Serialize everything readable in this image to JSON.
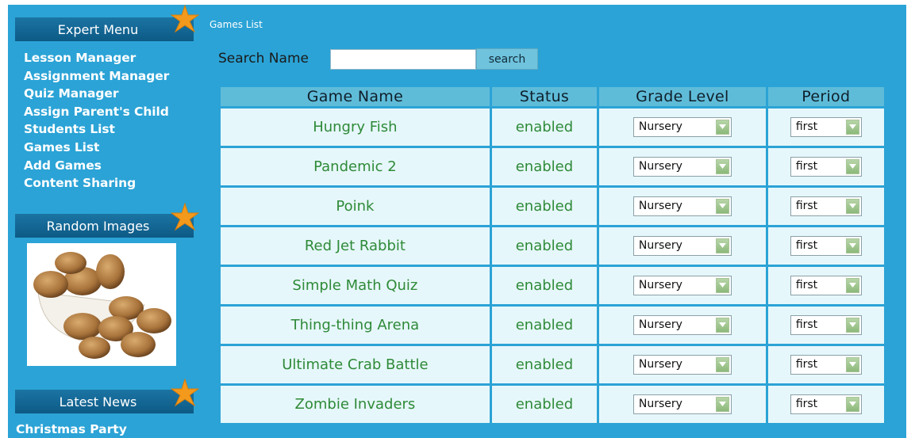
{
  "sidebar": {
    "expert_menu_title": "Expert Menu",
    "menu_items": [
      "Lesson Manager",
      "Assignment Manager",
      "Quiz Manager",
      "Assign Parent's Child",
      "Students List",
      "Games List",
      "Add Games",
      "Content Sharing"
    ],
    "random_images_title": "Random Images",
    "random_image_icon": "potatoes-in-bowl-image",
    "latest_news_title": "Latest News",
    "news_items": [
      "Christmas Party"
    ]
  },
  "breadcrumb": "Games List",
  "search": {
    "label": "Search Name",
    "value": "",
    "button_label": "search"
  },
  "table": {
    "headers": [
      "Game Name",
      "Status",
      "Grade Level",
      "Period"
    ],
    "rows": [
      {
        "name": "Hungry Fish",
        "status": "enabled",
        "grade": "Nursery",
        "period": "first"
      },
      {
        "name": "Pandemic 2",
        "status": "enabled",
        "grade": "Nursery",
        "period": "first"
      },
      {
        "name": "Poink",
        "status": "enabled",
        "grade": "Nursery",
        "period": "first"
      },
      {
        "name": "Red Jet Rabbit",
        "status": "enabled",
        "grade": "Nursery",
        "period": "first"
      },
      {
        "name": "Simple Math Quiz",
        "status": "enabled",
        "grade": "Nursery",
        "period": "first"
      },
      {
        "name": "Thing-thing Arena",
        "status": "enabled",
        "grade": "Nursery",
        "period": "first"
      },
      {
        "name": "Ultimate Crab Battle",
        "status": "enabled",
        "grade": "Nursery",
        "period": "first"
      },
      {
        "name": "Zombie Invaders",
        "status": "enabled",
        "grade": "Nursery",
        "period": "first"
      }
    ]
  },
  "colors": {
    "background": "#2ba3d6",
    "header_bar": "#0d5a86",
    "star": "#f39a1d",
    "game_text": "#2e8a37",
    "table_header": "#5fbcd9",
    "cell": "#e6f7fb"
  }
}
